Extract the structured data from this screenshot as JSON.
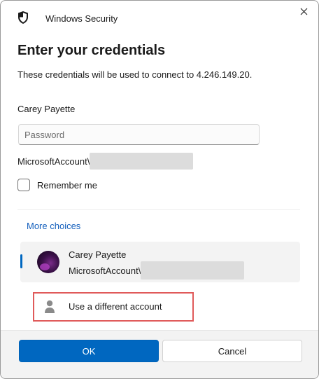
{
  "window": {
    "title": "Windows Security",
    "icon": "shield-icon",
    "close_icon": "close-icon"
  },
  "heading": "Enter your credentials",
  "description": "These credentials will be used to connect to 4.246.149.20.",
  "username": "Carey Payette",
  "password_field": {
    "placeholder": "Password",
    "value": ""
  },
  "domain_prefix": "MicrosoftAccount\\",
  "remember_me": {
    "label": "Remember me",
    "checked": false
  },
  "more_choices_label": "More choices",
  "accounts": [
    {
      "name": "Carey Payette",
      "domain_prefix": "MicrosoftAccount\\",
      "selected": true
    }
  ],
  "different_account_label": "Use a different account",
  "buttons": {
    "ok": "OK",
    "cancel": "Cancel"
  },
  "colors": {
    "accent": "#0067c0",
    "link": "#1560bd",
    "highlight_border": "#e05a5a"
  }
}
